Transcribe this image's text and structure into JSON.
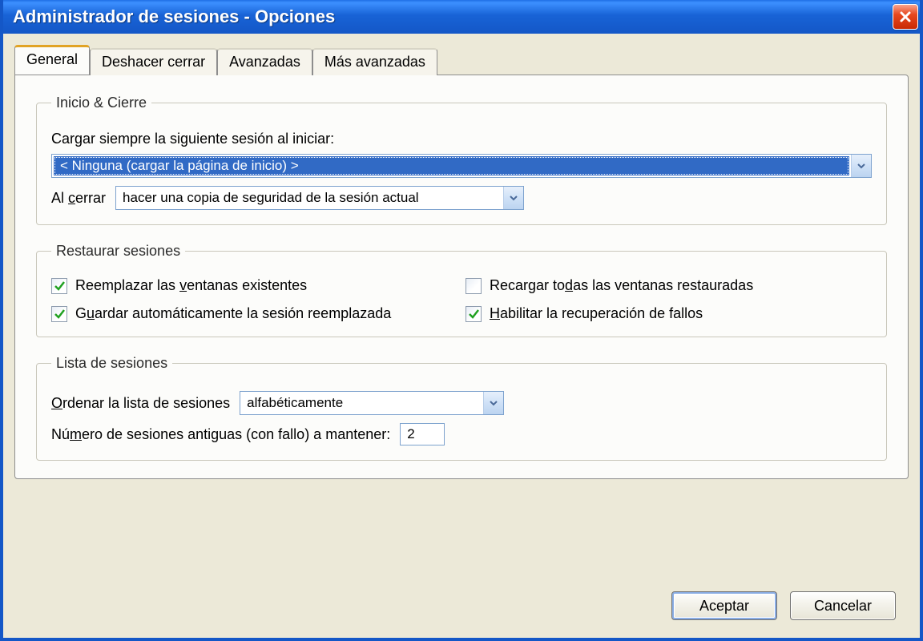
{
  "window": {
    "title": "Administrador de sesiones - Opciones"
  },
  "tabs": [
    {
      "label": "General",
      "active": true
    },
    {
      "label": "Deshacer cerrar",
      "active": false
    },
    {
      "label": "Avanzadas",
      "active": false
    },
    {
      "label": "Más avanzadas",
      "active": false
    }
  ],
  "groups": {
    "startup": {
      "legend": "Inicio & Cierre",
      "load_label": "Cargar siempre la siguiente sesión al iniciar:",
      "load_value": "< Ninguna (cargar la página de inicio) >",
      "close_label": "Al cerrar",
      "close_value": "hacer una copia de seguridad de la sesión actual"
    },
    "restore": {
      "legend": "Restaurar sesiones",
      "replace_label": "Reemplazar las ventanas existentes",
      "replace_checked": true,
      "reload_label": "Recargar todas las ventanas restauradas",
      "reload_checked": false,
      "autosave_label": "Guardar automáticamente la sesión reemplazada",
      "autosave_checked": true,
      "crash_label": "Habilitar la recuperación de fallos",
      "crash_checked": true
    },
    "list": {
      "legend": "Lista de sesiones",
      "sort_label": "Ordenar la lista de sesiones",
      "sort_value": "alfabéticamente",
      "keep_label": "Número de sesiones antiguas (con fallo) a mantener:",
      "keep_value": "2"
    }
  },
  "buttons": {
    "ok": "Aceptar",
    "cancel": "Cancelar"
  }
}
